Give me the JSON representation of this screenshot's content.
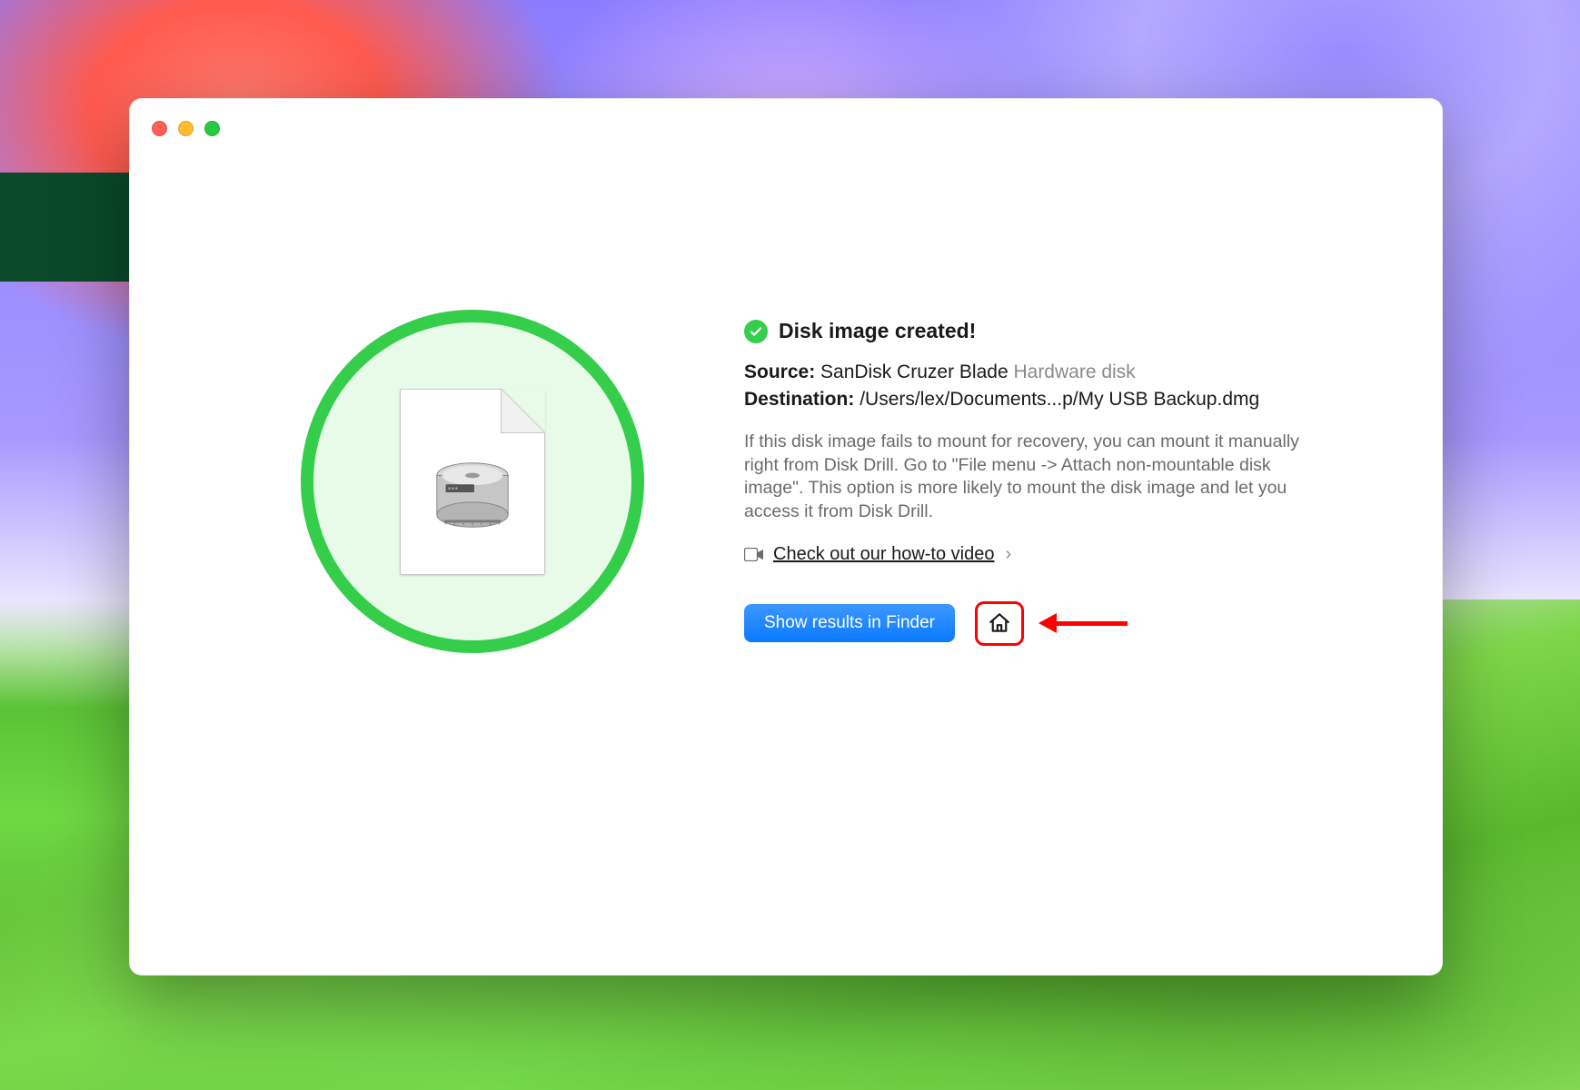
{
  "title": "Disk image created!",
  "source": {
    "label": "Source:",
    "value": "SanDisk Cruzer Blade",
    "type": "Hardware disk"
  },
  "destination": {
    "label": "Destination:",
    "value": "/Users/lex/Documents...p/My USB Backup.dmg"
  },
  "help_text": "If this disk image fails to mount for recovery, you can mount it manually right from Disk Drill. Go to \"File menu -> Attach non-mountable disk image\". This option is more likely to mount the disk image and let you access it from Disk Drill.",
  "video_link": "Check out our how-to video",
  "primary_button": "Show results in Finder",
  "icons": {
    "check": "checkmark-icon",
    "disk_doc": "disk-image-document-icon",
    "video": "video-camera-icon",
    "home": "home-icon",
    "chevron": "›"
  },
  "annotation": {
    "arrow_target": "home-button"
  }
}
